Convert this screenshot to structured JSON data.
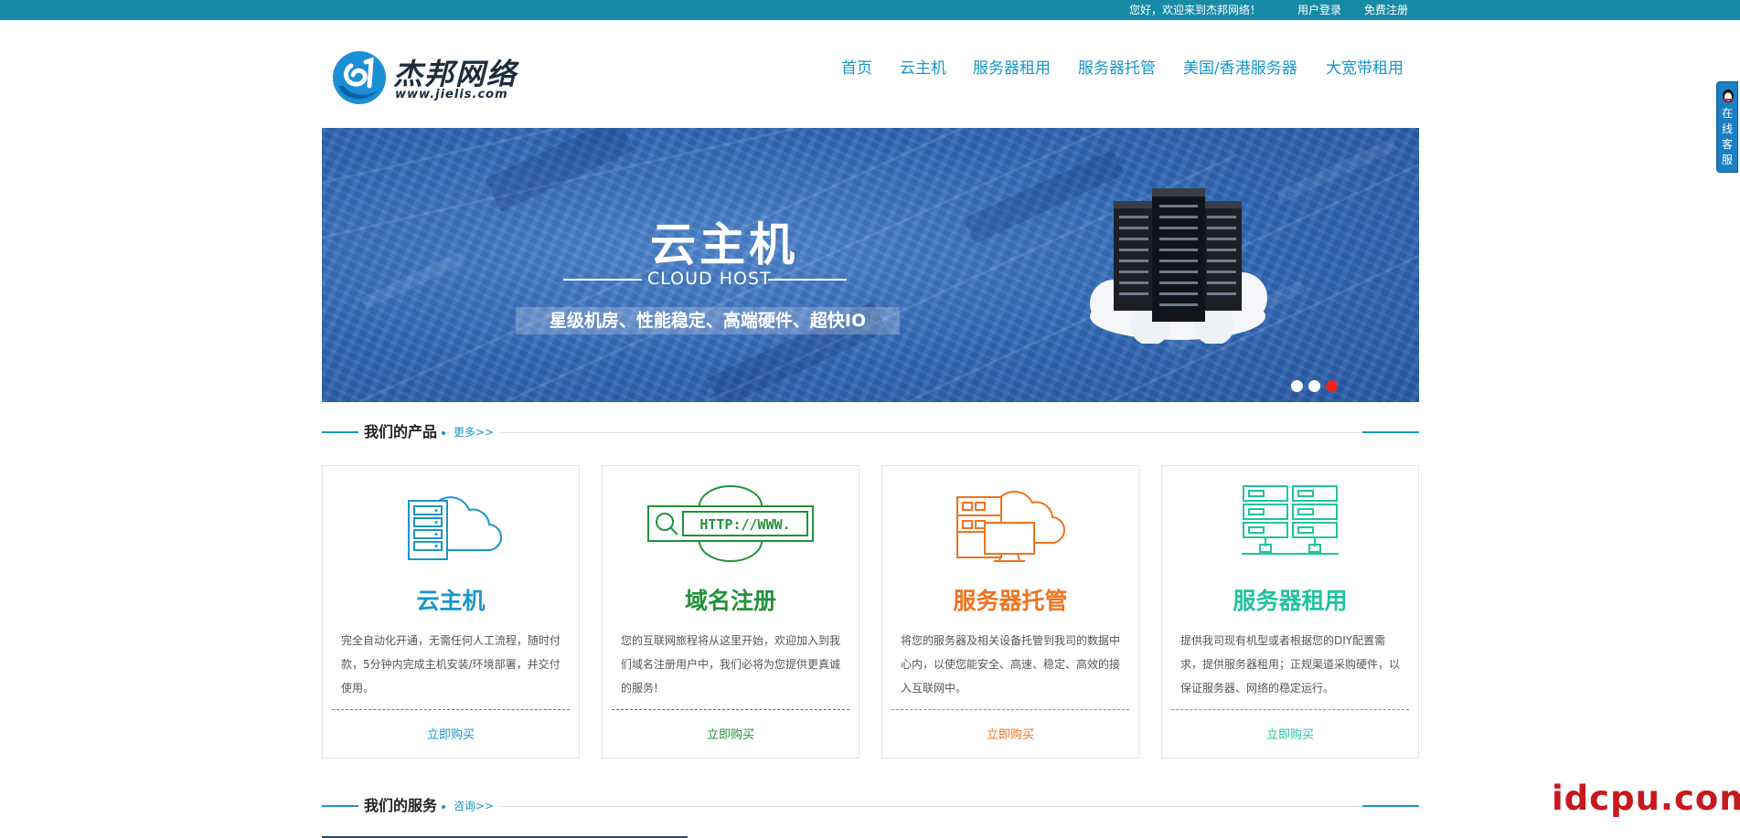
{
  "topbar": {
    "welcome": "您好，欢迎来到杰邦网络！",
    "login": "用户登录",
    "register": "免费注册",
    "bg_color": "#178ba6"
  },
  "logo": {
    "name": "杰邦网络",
    "url": "www.jielis.com"
  },
  "nav": {
    "items": [
      {
        "label": "首页"
      },
      {
        "label": "云主机"
      },
      {
        "label": "服务器租用"
      },
      {
        "label": "服务器托管"
      },
      {
        "label": "美国/香港服务器"
      },
      {
        "label": "大宽带租用"
      }
    ],
    "color": "#1a96c8"
  },
  "banner": {
    "title": "云主机",
    "subtitle": "CLOUD HOST",
    "tagline": "星级机房、性能稳定、高端硬件、超快IO",
    "slides": 3,
    "active_slide": 3
  },
  "products_section": {
    "title": "我们的产品",
    "more": "更多>>"
  },
  "products": [
    {
      "icon": "cloud-host-icon",
      "title": "云主机",
      "desc": "完全自动化开通，无需任何人工流程，随时付款，5分钟内完成主机安装/环境部署，并交付使用。",
      "buy": "立即购买",
      "color": "#1a96c8"
    },
    {
      "icon": "domain-http-icon",
      "title": "域名注册",
      "desc": "您的互联网旅程将从这里开始，欢迎加入到我们域名注册用户中，我们必将为您提供更真诚的服务!",
      "buy": "立即购买",
      "color": "#23923a",
      "icon_text": "HTTP://WWW."
    },
    {
      "icon": "server-hosting-icon",
      "title": "服务器托管",
      "desc": "将您的服务器及相关设备托管到我司的数据中心内，以使您能安全、高速、稳定、高效的接入互联网中。",
      "buy": "立即购买",
      "color": "#f0731f"
    },
    {
      "icon": "server-rental-icon",
      "title": "服务器租用",
      "desc": "提供我司现有机型或者根据您的DIY配置需求，提供服务器租用；正规渠道采购硬件，以保证服务器、网络的稳定运行。",
      "buy": "立即购买",
      "color": "#22c3a0"
    }
  ],
  "services_section": {
    "title": "我们的服务",
    "more": "咨询>>"
  },
  "side_tab": {
    "text": "在\n线\n客\n服"
  },
  "watermark": "idcpu.com"
}
